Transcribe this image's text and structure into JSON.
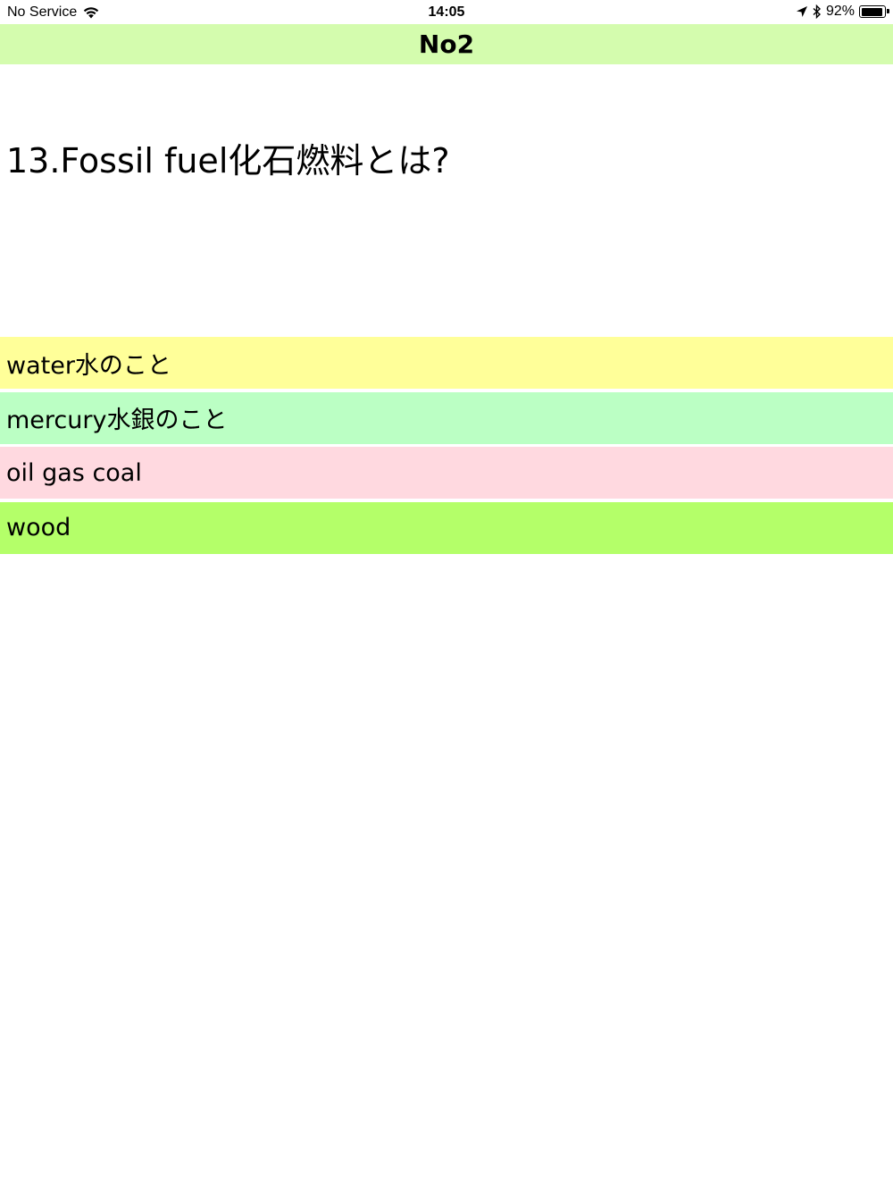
{
  "status_bar": {
    "carrier": "No Service",
    "time": "14:05",
    "battery_percent": "92%",
    "battery_level": 0.92
  },
  "nav": {
    "title": "No2"
  },
  "question": {
    "text": "13.Fossil fuel化石燃料とは?"
  },
  "answers": [
    {
      "label": "water水のこと",
      "color": "#ffff99"
    },
    {
      "label": "mercury水銀のこと",
      "color": "#bbffc4"
    },
    {
      "label": "oil gas coal",
      "color": "#ffd9e0"
    },
    {
      "label": "wood",
      "color": "#b4ff69"
    }
  ]
}
